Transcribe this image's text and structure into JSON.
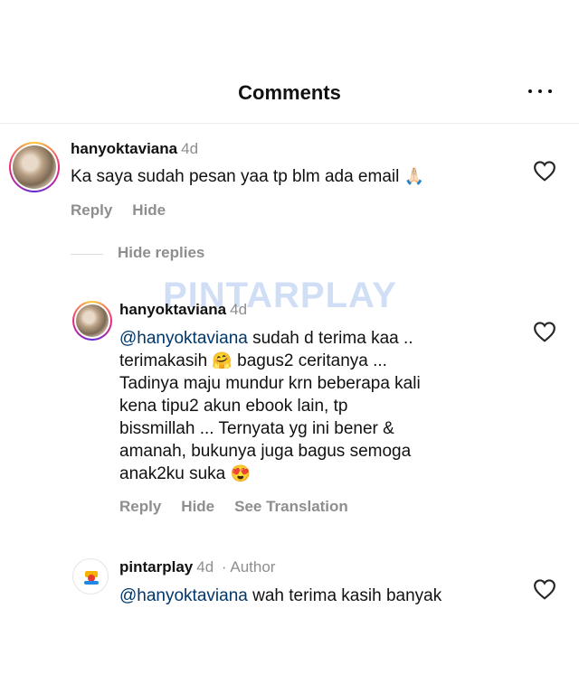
{
  "header": {
    "title": "Comments"
  },
  "comments": [
    {
      "username": "hanyoktaviana",
      "time": "4d",
      "text": "Ka saya sudah pesan yaa tp blm ada email",
      "emoji": "🙏🏻",
      "actions": {
        "reply": "Reply",
        "hide": "Hide"
      }
    }
  ],
  "replies_toggle": "Hide replies",
  "watermark": "PINTARPLAY",
  "reply1": {
    "username": "hanyoktaviana",
    "time": "4d",
    "mention": "@hanyoktaviana",
    "line1": " sudah d terima kaa ..",
    "line2a": "terimakasih ",
    "emoji1": "🤗",
    "line2b": " bagus2 ceritanya ...",
    "line3": "Tadinya maju mundur krn beberapa kali",
    "line4": "kena tipu2 akun ebook lain, tp",
    "line5": "bissmillah ... Ternyata yg ini bener &",
    "line6": "amanah, bukunya juga bagus semoga",
    "line7": "anak2ku suka ",
    "emoji2": "😍",
    "actions": {
      "reply": "Reply",
      "hide": "Hide",
      "translate": "See Translation"
    }
  },
  "reply2": {
    "username": "pintarplay",
    "time": "4d",
    "author_tag": "· Author",
    "mention": "@hanyoktaviana",
    "text": " wah terima kasih banyak"
  }
}
